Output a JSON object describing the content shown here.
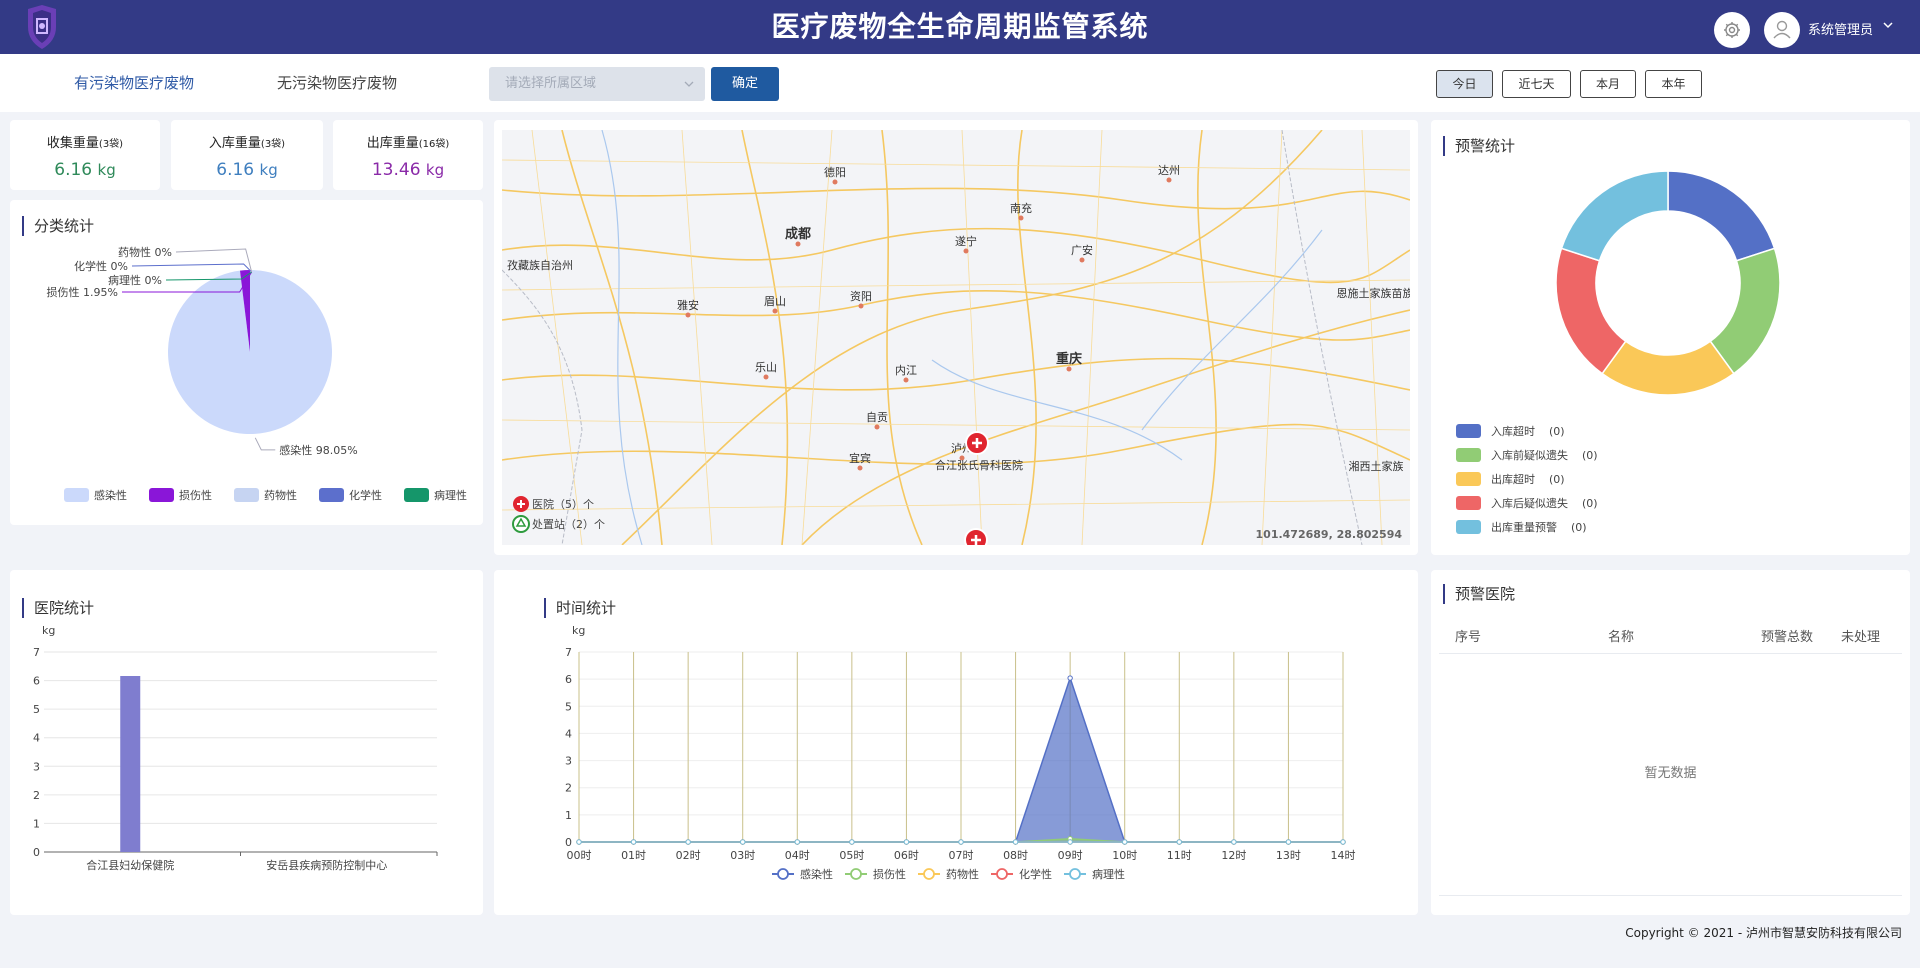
{
  "header": {
    "title": "医疗废物全生命周期监管系统",
    "user_name": "系统管理员"
  },
  "filters": {
    "tabs": [
      "有污染物医疗废物",
      "无污染物医疗废物"
    ],
    "region_placeholder": "请选择所属区域",
    "confirm_label": "确定",
    "ranges": [
      "今日",
      "近七天",
      "本月",
      "本年"
    ]
  },
  "metrics": [
    {
      "label": "收集重量",
      "count": "(3袋)",
      "value": "6.16",
      "unit": "kg",
      "color": "#2f8a5a"
    },
    {
      "label": "入库重量",
      "count": "(3袋)",
      "value": "6.16",
      "unit": "kg",
      "color": "#3f7fbf"
    },
    {
      "label": "出库重量",
      "count": "(16袋)",
      "value": "13.46",
      "unit": "kg",
      "color": "#8a2aa8"
    }
  ],
  "category_stats": {
    "title": "分类统计",
    "chart_data": {
      "type": "pie",
      "slices": [
        {
          "name": "感染性",
          "value": 98.05,
          "label": "感染性 98.05%",
          "color": "#cbd9fb"
        },
        {
          "name": "损伤性",
          "value": 1.95,
          "label": "损伤性 1.95%",
          "color": "#8a16d8"
        },
        {
          "name": "药物性",
          "value": 0,
          "label": "药物性 0%",
          "color": "#c6d4f2"
        },
        {
          "name": "化学性",
          "value": 0,
          "label": "化学性 0%",
          "color": "#5c6fcc"
        },
        {
          "name": "病理性",
          "value": 0,
          "label": "病理性 0%",
          "color": "#15966a"
        }
      ],
      "legend": [
        "感染性",
        "损伤性",
        "药物性",
        "化学性",
        "病理性"
      ]
    }
  },
  "map": {
    "labels": [
      "德阳",
      "达州",
      "南充",
      "成都",
      "遂宁",
      "广安",
      "孜藏族自治州",
      "雅安",
      "眉山",
      "资阳",
      "恩施土家族苗族",
      "重庆",
      "乐山",
      "内江",
      "自贡",
      "泸州",
      "合江张氏骨科医院",
      "宜宾",
      "湘西土家族"
    ],
    "legend": [
      {
        "icon": "hospital-icon",
        "text": "医院（5）个"
      },
      {
        "icon": "recycle-icon",
        "text": "处置站（2）个"
      }
    ],
    "coords": "101.472689, 28.802594"
  },
  "warning_stats": {
    "title": "预警统计",
    "chart_data": {
      "type": "pie",
      "slices": [
        {
          "name": "入库超时",
          "value": 0,
          "color": "#5470c6"
        },
        {
          "name": "入库前疑似遗失",
          "value": 0,
          "color": "#91cc75"
        },
        {
          "name": "出库超时",
          "value": 0,
          "color": "#fac858"
        },
        {
          "name": "入库后疑似遗失",
          "value": 0,
          "color": "#ee6666"
        },
        {
          "name": "出库重量预警",
          "value": 0,
          "color": "#73c0de"
        }
      ]
    },
    "legend_counts": [
      "(0)",
      "(0)",
      "(0)",
      "(0)",
      "(0)"
    ]
  },
  "hospital_stats": {
    "title": "医院统计",
    "chart_data": {
      "type": "bar",
      "ylabel": "kg",
      "ylim": [
        0,
        7
      ],
      "yticks": [
        0,
        1,
        2,
        3,
        4,
        5,
        6,
        7
      ],
      "categories": [
        "合江县妇幼保健院",
        "安岳县疾病预防控制中心"
      ],
      "values": [
        6.16,
        0
      ],
      "color": "#7f7dcf"
    }
  },
  "time_stats": {
    "title": "时间统计",
    "chart_data": {
      "type": "area",
      "ylabel": "kg",
      "ylim": [
        0,
        7
      ],
      "yticks": [
        0,
        1,
        2,
        3,
        4,
        5,
        6,
        7
      ],
      "x": [
        "00时",
        "01时",
        "02时",
        "03时",
        "04时",
        "05时",
        "06时",
        "07时",
        "08时",
        "09时",
        "10时",
        "11时",
        "12时",
        "13时",
        "14时"
      ],
      "series": [
        {
          "name": "感染性",
          "color": "#5470c6",
          "values": [
            0,
            0,
            0,
            0,
            0,
            0,
            0,
            0,
            0,
            6.04,
            0,
            0,
            0,
            0,
            0
          ]
        },
        {
          "name": "损伤性",
          "color": "#91cc75",
          "values": [
            0,
            0,
            0,
            0,
            0,
            0,
            0,
            0,
            0,
            0.12,
            0,
            0,
            0,
            0,
            0
          ]
        },
        {
          "name": "药物性",
          "color": "#fac858",
          "values": [
            0,
            0,
            0,
            0,
            0,
            0,
            0,
            0,
            0,
            0,
            0,
            0,
            0,
            0,
            0
          ]
        },
        {
          "name": "化学性",
          "color": "#ee6666",
          "values": [
            0,
            0,
            0,
            0,
            0,
            0,
            0,
            0,
            0,
            0,
            0,
            0,
            0,
            0,
            0
          ]
        },
        {
          "name": "病理性",
          "color": "#73c0de",
          "values": [
            0,
            0,
            0,
            0,
            0,
            0,
            0,
            0,
            0,
            0,
            0,
            0,
            0,
            0,
            0
          ]
        }
      ]
    }
  },
  "warning_hospitals": {
    "title": "预警医院",
    "columns": [
      "序号",
      "名称",
      "预警总数",
      "未处理"
    ],
    "empty_text": "暂无数据"
  },
  "footer": {
    "copyright": "Copyright © 2021 - 泸州市智慧安防科技有限公司"
  }
}
